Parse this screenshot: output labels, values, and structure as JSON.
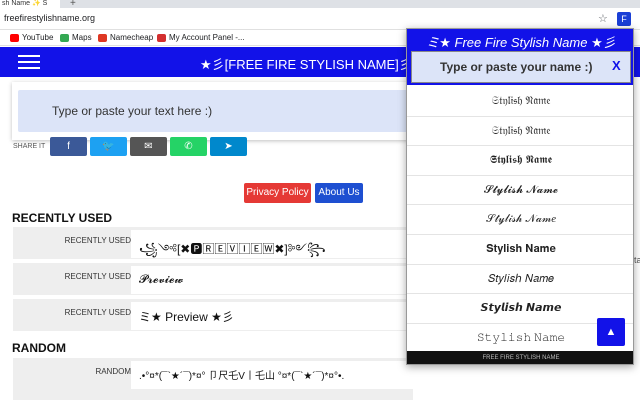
{
  "browser": {
    "tab_title": "sh Name ✨ S",
    "url": "freefirestylishname.org",
    "extension_label": "F"
  },
  "bookmarks": [
    {
      "label": "YouTube",
      "color": "#ff0000"
    },
    {
      "label": "Maps",
      "color": "#34a853"
    },
    {
      "label": "Namecheap",
      "color": "#de3723"
    },
    {
      "label": "My Account Panel -...",
      "color": "#d32f2f"
    }
  ],
  "navbar": {
    "title": "★彡[FREE FIRE STYLISH NAME]彡★"
  },
  "main": {
    "input_placeholder": "Type or paste your text here :)",
    "share_label": "SHARE IT",
    "share_buttons": [
      {
        "name": "facebook",
        "glyph": "f",
        "color": "#3b5998"
      },
      {
        "name": "twitter",
        "glyph": "🐦",
        "color": "#1da1f2"
      },
      {
        "name": "email",
        "glyph": "✉",
        "color": "#555555"
      },
      {
        "name": "whatsapp",
        "glyph": "✆",
        "color": "#25d366"
      },
      {
        "name": "telegram",
        "glyph": "➤",
        "color": "#0088cc"
      }
    ],
    "privacy_label": "Privacy Policy",
    "about_label": "About Us",
    "recently_used_title": "RECENTLY USED",
    "recently_used": [
      {
        "label": "RECENTLY USED",
        "value": "꧁༺[✖🅿🅁🄴🅅🄸🄴🅆✖]༻꧂"
      },
      {
        "label": "RECENTLY USED",
        "value": "𝓟𝓻𝓮𝓿𝓲𝓮𝔀"
      },
      {
        "label": "RECENTLY USED",
        "value": "ミ★ Preview ★彡"
      }
    ],
    "random_title": "RANDOM",
    "random": [
      {
        "label": "RANDOM",
        "value": ".•°¤*(¯`★´¯)*¤° 卩尺乇V丨乇山 °¤*(¯`★´¯)*¤°•."
      }
    ]
  },
  "popup": {
    "title": "ミ★ Free Fire Stylish Name ★彡",
    "input_placeholder": "Type or paste your name :)",
    "close_label": "X",
    "names": [
      "𝔖𝔱𝔶𝔩𝔦𝔰𝔥 𝔑𝔞𝔪𝔢",
      "𝔖𝔱𝔶𝔩𝔦𝔰𝔥 𝔑𝔞𝔪𝔢",
      "𝕾𝖙𝖞𝖑𝖎𝖘𝖍 𝕹𝖆𝖒𝖊",
      "𝓢𝓽𝔂𝓵𝓲𝓼𝓱 𝓝𝓪𝓶𝓮",
      "𝒮𝓉𝓎𝓁𝒾𝓈𝒽 𝒩𝒶𝓂𝑒",
      "𝐒𝐭𝐲𝐥𝐢𝐬𝐡 𝐍𝐚𝐦𝐞",
      "𝑆𝑡𝑦𝑙𝑖𝑠ℎ 𝑁𝑎𝑚𝑒",
      "𝙎𝙩𝙮𝙡𝙞𝙨𝙝 𝙉𝙖𝙢𝙚",
      "𝚂𝚝𝚢𝚕𝚒𝚜𝚑 𝙽𝚊𝚖𝚎"
    ],
    "footer": "FREE FIRE STYLISH NAME",
    "scroll_up_glyph": "▲"
  },
  "edge_text": "ta"
}
